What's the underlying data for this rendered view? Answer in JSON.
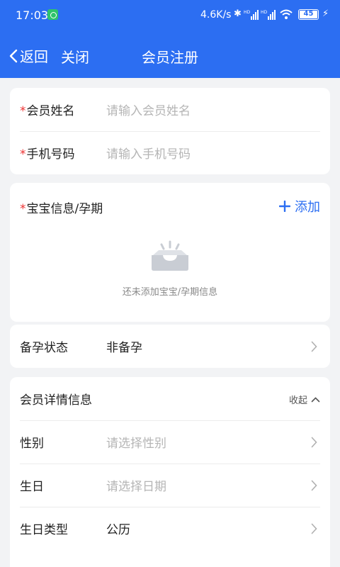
{
  "status_bar": {
    "time": "17:03",
    "net_speed": "4.6K/s",
    "battery": "45",
    "signal_tag": "HD"
  },
  "nav": {
    "back_label": "返回",
    "close_label": "关闭",
    "title": "会员注册"
  },
  "basic": {
    "name_label": "会员姓名",
    "name_placeholder": "请输入会员姓名",
    "phone_label": "手机号码",
    "phone_placeholder": "请输入手机号码",
    "required_mark": "*"
  },
  "baby": {
    "label": "宝宝信息/孕期",
    "add_label": "添加",
    "empty_text": "还未添加宝宝/孕期信息"
  },
  "pregnancy": {
    "label": "备孕状态",
    "value": "非备孕"
  },
  "details": {
    "header": "会员详情信息",
    "collapse_label": "收起",
    "gender_label": "性别",
    "gender_placeholder": "请选择性别",
    "birthday_label": "生日",
    "birthday_placeholder": "请选择日期",
    "birthday_type_label": "生日类型",
    "birthday_type_value": "公历"
  },
  "colors": {
    "brand": "#2c6ef2",
    "required": "#ee3333",
    "placeholder": "#b5b5b5"
  }
}
